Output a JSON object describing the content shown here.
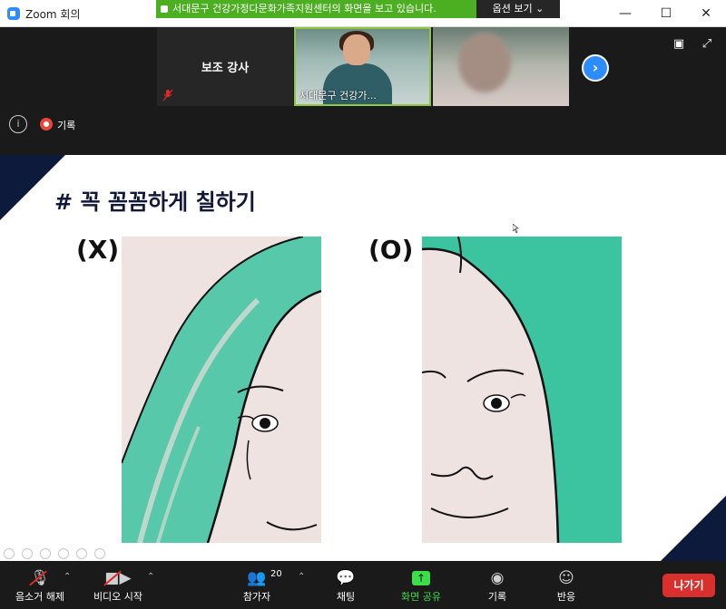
{
  "window": {
    "title": "Zoom 회의",
    "minimize_glyph": "—",
    "maximize_glyph": "☐",
    "close_glyph": "✕"
  },
  "share_banner": {
    "text": "서대문구 건강가정다문화가족지원센터의 화면을 보고 있습니다.",
    "options_label": "옵션 보기 ⌄"
  },
  "video_strip": {
    "assistant_tile": {
      "name": "보조 강사"
    },
    "speaker_tile": {
      "name": "서대문구 건강가..."
    },
    "next_arrow": "›",
    "view_icons": [
      "▣",
      "⤢"
    ]
  },
  "meeting_status": {
    "info_glyph": "i",
    "recording_label": "기록"
  },
  "slide": {
    "title": "# 꼭 꼼꼼하게 칠하기",
    "label_bad": "(X)",
    "label_good": "(O)",
    "hair_color": "#3cc4a0",
    "paper_color": "#efe3e1"
  },
  "toolbar": {
    "mute": {
      "label": "음소거 해제",
      "icon": "microphone-icon"
    },
    "video": {
      "label": "비디오 시작",
      "icon": "video-camera-icon"
    },
    "participants": {
      "label": "참가자",
      "count": "20",
      "icon": "participants-icon"
    },
    "chat": {
      "label": "채팅",
      "icon": "chat-icon"
    },
    "share": {
      "label": "화면 공유",
      "icon": "share-screen-icon"
    },
    "record": {
      "label": "기록",
      "icon": "record-icon"
    },
    "reactions": {
      "label": "반응",
      "icon": "reaction-icon"
    },
    "leave": {
      "label": "나가기"
    },
    "caret": "⌃"
  }
}
